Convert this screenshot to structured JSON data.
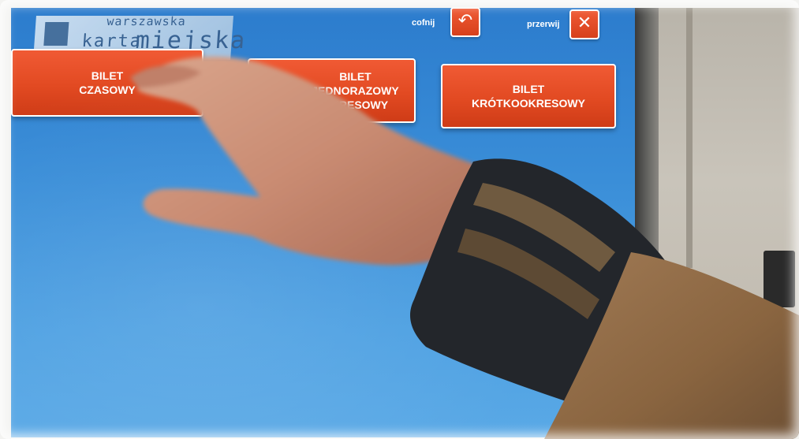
{
  "logo": {
    "line1": "warszawska",
    "line2": "karta",
    "line3": "miejska"
  },
  "controls": {
    "back_label": "cofnij",
    "back_icon": "undo-arrow-icon",
    "cancel_label": "przerwij",
    "cancel_icon": "close-icon"
  },
  "tickets": [
    {
      "label": "BILET\nCZASOWY"
    },
    {
      "label": "BILET\nJEDNORAZOWY\nOKRESOWY"
    },
    {
      "label": "BILET\nKRÓTKOOKRESOWY"
    }
  ],
  "colors": {
    "screen": "#3a8ed8",
    "button": "#e24a22",
    "button_border": "#ffffff"
  }
}
